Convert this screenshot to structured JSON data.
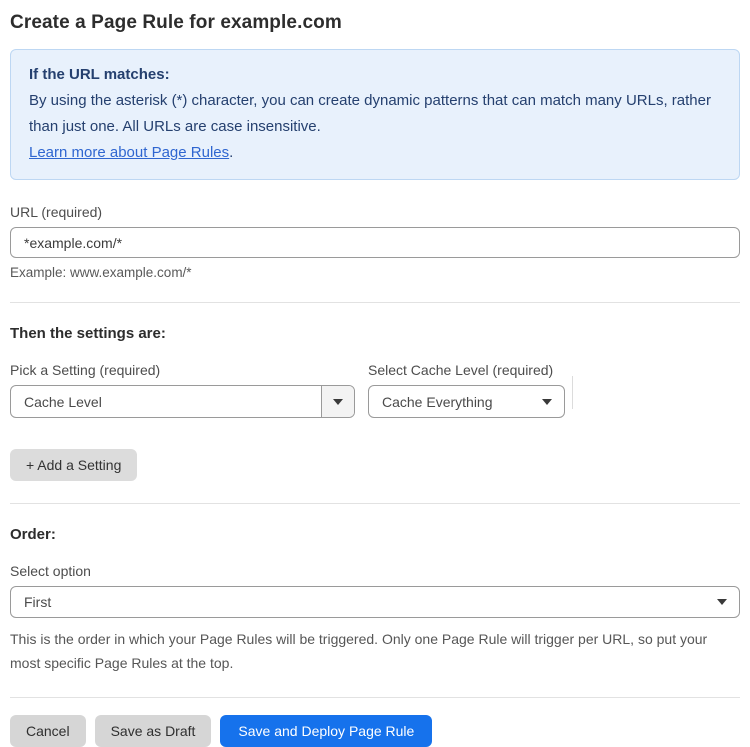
{
  "page": {
    "title": "Create a Page Rule for example.com"
  },
  "info_box": {
    "heading": "If the URL matches:",
    "body": "By using the asterisk (*) character, you can create dynamic patterns that can match many URLs, rather than just one. All URLs are case insensitive.",
    "link_label": "Learn more about Page Rules",
    "link_suffix": "."
  },
  "url_field": {
    "label": "URL (required)",
    "value": "*example.com/*",
    "helper": "Example: www.example.com/*"
  },
  "settings_section": {
    "heading": "Then the settings are:",
    "setting_picker": {
      "label": "Pick a Setting (required)",
      "value": "Cache Level"
    },
    "cache_level_picker": {
      "label": "Select Cache Level (required)",
      "value": "Cache Everything"
    },
    "add_setting_label": "+ Add a Setting"
  },
  "order_section": {
    "heading": "Order:",
    "label": "Select option",
    "value": "First",
    "helper": "This is the order in which your Page Rules will be triggered. Only one Page Rule will trigger per URL, so put your most specific Page Rules at the top."
  },
  "footer": {
    "cancel_label": "Cancel",
    "save_draft_label": "Save as Draft",
    "deploy_label": "Save and Deploy Page Rule"
  },
  "icons": {
    "dropdown_arrow": "caret-down-icon"
  },
  "colors": {
    "accent_blue": "#1672ec",
    "info_background": "#e8f1fc",
    "info_border": "#bdd7f3",
    "info_text": "#25406f",
    "link_blue": "#2f66d0",
    "button_gray": "#d6d6d6"
  }
}
